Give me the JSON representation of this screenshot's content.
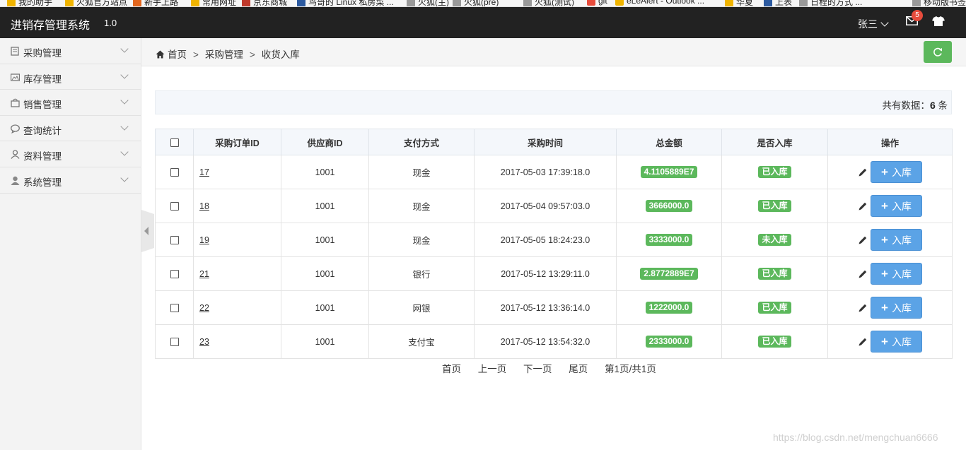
{
  "bookmarks": [
    "我的助手",
    "火狐官方站点",
    "新手上路",
    "常用网址",
    "京东商城",
    "鸟哥的 Linux 私房菜 ...",
    "火狐(主)",
    "火狐(pre)",
    "火狐(测试)",
    "git",
    "eLeAlert - Outlook ...",
    "华夏",
    "上表",
    "日程的方式 ...",
    "移动版书签"
  ],
  "navbar": {
    "brand": "进销存管理系统",
    "version": "1.0",
    "user": "张三",
    "mail_count": "5"
  },
  "sidebar": {
    "items": [
      {
        "label": "采购管理",
        "icon": "book-icon"
      },
      {
        "label": "库存管理",
        "icon": "picture-icon"
      },
      {
        "label": "销售管理",
        "icon": "shopping-bag-icon"
      },
      {
        "label": "查询统计",
        "icon": "comment-icon"
      },
      {
        "label": "资料管理",
        "icon": "user-outline-icon"
      },
      {
        "label": "系统管理",
        "icon": "user-icon"
      }
    ]
  },
  "breadcrumb": {
    "home": "首页",
    "level1": "采购管理",
    "level2": "收货入库",
    "separator": ">"
  },
  "summary": {
    "prefix": "共有数据：",
    "count": "6",
    "suffix": " 条"
  },
  "table": {
    "headers": [
      "采购订单ID",
      "供应商ID",
      "支付方式",
      "采购时间",
      "总金额",
      "是否入库",
      "操作"
    ],
    "button_label": "入库",
    "rows": [
      {
        "id": "17",
        "supplier": "1001",
        "payment": "现金",
        "time": "2017-05-03 17:39:18.0",
        "amount": "4.1105889E7",
        "status": "已入库"
      },
      {
        "id": "18",
        "supplier": "1001",
        "payment": "现金",
        "time": "2017-05-04 09:57:03.0",
        "amount": "3666000.0",
        "status": "已入库"
      },
      {
        "id": "19",
        "supplier": "1001",
        "payment": "现金",
        "time": "2017-05-05 18:24:23.0",
        "amount": "3333000.0",
        "status": "未入库"
      },
      {
        "id": "21",
        "supplier": "1001",
        "payment": "银行",
        "time": "2017-05-12 13:29:11.0",
        "amount": "2.8772889E7",
        "status": "已入库"
      },
      {
        "id": "22",
        "supplier": "1001",
        "payment": "网银",
        "time": "2017-05-12 13:36:14.0",
        "amount": "1222000.0",
        "status": "已入库"
      },
      {
        "id": "23",
        "supplier": "1001",
        "payment": "支付宝",
        "time": "2017-05-12 13:54:32.0",
        "amount": "2333000.0",
        "status": "已入库"
      }
    ]
  },
  "pager": {
    "first": "首页",
    "prev": "上一页",
    "next": "下一页",
    "last": "尾页",
    "info": "第1页/共1页"
  },
  "watermark": "https://blog.csdn.net/mengchuan6666",
  "colors": {
    "navbar": "#222222",
    "success": "#5cb85c",
    "primary_button": "#5ba3e6",
    "sidebar": "#f3f3f3"
  }
}
